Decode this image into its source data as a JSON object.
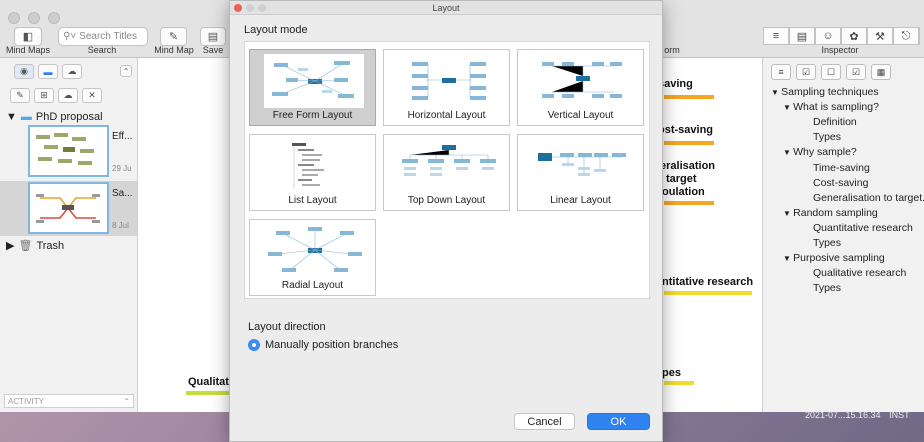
{
  "toolbar": {
    "search_placeholder": "Search Titles",
    "labels": {
      "mind_maps": "Mind Maps",
      "search": "Search",
      "mind_map": "Mind Map",
      "save": "Save",
      "form": "orm",
      "inspector": "Inspector"
    }
  },
  "sidebar": {
    "folder": "PhD proposal",
    "items": [
      {
        "title": "Eff...",
        "date": "29 Ju"
      },
      {
        "title": "Sa...",
        "date": "8 Jul"
      }
    ],
    "trash": "Trash",
    "activity": "ACTIVITY"
  },
  "canvas": {
    "fragments": [
      "saving",
      "ost-saving",
      "eralisation",
      "target",
      "oulation",
      "ntitative research",
      "Qualitat",
      "pes"
    ]
  },
  "inspector": {
    "outline": [
      {
        "text": "Sampling techniques",
        "level": 0,
        "expanded": true
      },
      {
        "text": "What is sampling?",
        "level": 1,
        "expanded": true
      },
      {
        "text": "Definition",
        "level": 2
      },
      {
        "text": "Types",
        "level": 2
      },
      {
        "text": "Why sample?",
        "level": 1,
        "expanded": true
      },
      {
        "text": "Time-saving",
        "level": 2
      },
      {
        "text": "Cost-saving",
        "level": 2
      },
      {
        "text": "Generalisation to target...",
        "level": 2
      },
      {
        "text": "Random sampling",
        "level": 1,
        "expanded": true
      },
      {
        "text": "Quantitative research",
        "level": 2
      },
      {
        "text": "Types",
        "level": 2
      },
      {
        "text": "Purposive sampling",
        "level": 1,
        "expanded": true
      },
      {
        "text": "Qualitative research",
        "level": 2
      },
      {
        "text": "Types",
        "level": 2
      }
    ]
  },
  "desktop": {
    "timestamp": "2021-07...15.16.34",
    "suffix": "INST"
  },
  "dialog": {
    "title": "Layout",
    "mode_heading": "Layout mode",
    "layouts": [
      {
        "label": "Free Form Layout",
        "selected": true
      },
      {
        "label": "Horizontal Layout",
        "selected": false
      },
      {
        "label": "Vertical Layout",
        "selected": false
      },
      {
        "label": "List Layout",
        "selected": false
      },
      {
        "label": "Top Down Layout",
        "selected": false
      },
      {
        "label": "Linear Layout",
        "selected": false
      },
      {
        "label": "Radial Layout",
        "selected": false
      }
    ],
    "direction_heading": "Layout direction",
    "direction_option": "Manually position branches",
    "cancel": "Cancel",
    "ok": "OK"
  },
  "colors": {
    "accent": "#2f83f0",
    "orange": "#f5a623",
    "yellow": "#f2dc2a",
    "lime": "#c8dc3c"
  }
}
